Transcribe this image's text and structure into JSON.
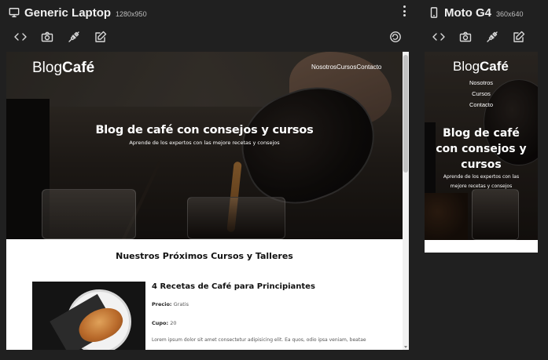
{
  "laptop": {
    "name": "Generic Laptop",
    "size": "1280x950"
  },
  "mobile": {
    "name": "Moto G4",
    "size": "360x640"
  },
  "site": {
    "logo_light": "Blog",
    "logo_bold": "Café",
    "nav": [
      "Nosotros",
      "Cursos",
      "Contacto"
    ],
    "hero_title": "Blog de café con consejos y cursos",
    "hero_title_mobile_lines": [
      "Blog de café",
      "con consejos y",
      "cursos"
    ],
    "hero_subtitle": "Aprende de los expertos con las mejore recetas y consejos",
    "hero_subtitle_mobile_lines": [
      "Aprende de los expertos con las",
      "mejore recetas y consejos"
    ],
    "section_title": "Nuestros Próximos Cursos y Talleres",
    "course": {
      "title": "4 Recetas de Café para Principiantes",
      "price_label": "Precio:",
      "price_value": "Gratis",
      "cupo_label": "Cupo:",
      "cupo_value": "20",
      "description": "Lorem ipsum dolor sit amet consectetur adipisicing elit. Ea quos, odio ipsa veniam, beatae"
    }
  },
  "icons": {
    "laptop": "monitor-icon",
    "mobile": "smartphone-icon",
    "toolbar": [
      "code-icon",
      "camera-icon",
      "plug-icon",
      "edit-icon",
      "rotate-icon"
    ]
  },
  "colors": {
    "app_bg": "#202020",
    "text": "#e8e8e8",
    "page_bg": "#ffffff"
  }
}
